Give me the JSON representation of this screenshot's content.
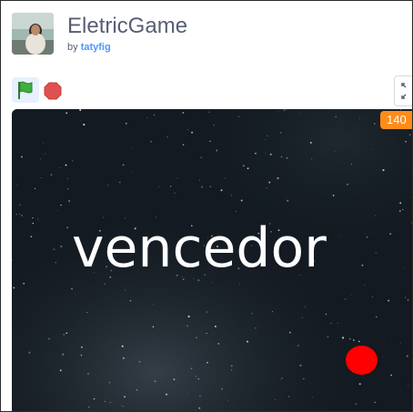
{
  "project": {
    "title": "EletricGame",
    "by_label": "by",
    "author": "tatyfig"
  },
  "controls": {
    "flag_color": "#3faf3f",
    "stop_color": "#e05050"
  },
  "stage": {
    "score_monitor": "140",
    "message": "vencedor",
    "ball_color": "#ff0000"
  }
}
